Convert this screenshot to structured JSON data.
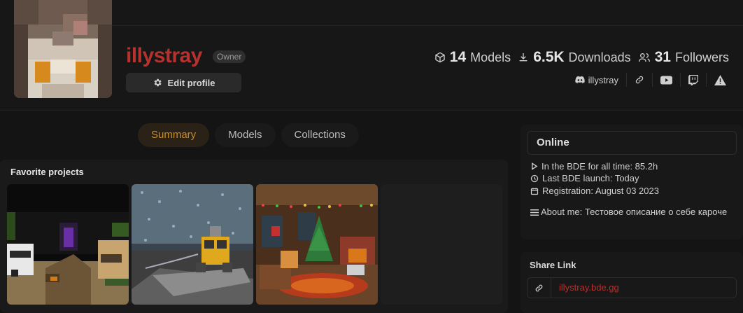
{
  "profile": {
    "username": "illystray",
    "role": "Owner",
    "edit_label": "Edit profile"
  },
  "stats": {
    "models_count": "14",
    "models_label": "Models",
    "downloads_count": "6.5K",
    "downloads_label": "Downloads",
    "followers_count": "31",
    "followers_label": "Followers"
  },
  "socials": {
    "discord": "illystray",
    "icons": [
      "discord-icon",
      "link-icon",
      "youtube-icon",
      "twitch-icon",
      "warning-icon"
    ]
  },
  "tabs": [
    {
      "label": "Summary",
      "active": true
    },
    {
      "label": "Models",
      "active": false
    },
    {
      "label": "Collections",
      "active": false
    }
  ],
  "favorites": {
    "title": "Favorite projects"
  },
  "sidebar": {
    "status": "Online",
    "bde_time": "In the BDE for all time: 85.2h",
    "last_launch": "Last BDE launch: Today",
    "registration": "Registration: August 03 2023",
    "about_label": "About me:",
    "about_text": "Тестовое описание о себе кароче"
  },
  "share": {
    "title": "Share Link",
    "url": "illystray.bde.gg"
  },
  "colors": {
    "accent": "#b5322f",
    "tab_active": "#c98a28",
    "background": "#141414"
  }
}
